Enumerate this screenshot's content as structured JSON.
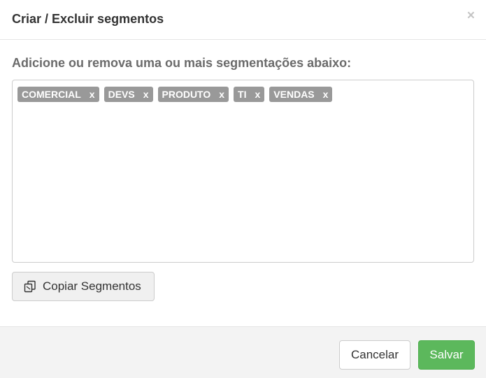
{
  "header": {
    "title": "Criar / Excluir segmentos",
    "close_label": "×"
  },
  "body": {
    "instruction": "Adicione ou remova uma ou mais segmentações abaixo:",
    "tags": [
      {
        "label": "COMERCIAL",
        "remove": "x"
      },
      {
        "label": "DEVS",
        "remove": "x"
      },
      {
        "label": "PRODUTO",
        "remove": "x"
      },
      {
        "label": "TI",
        "remove": "x"
      },
      {
        "label": "VENDAS",
        "remove": "x"
      }
    ],
    "copy_button": {
      "label": "Copiar Segmentos",
      "icon": "copy-icon"
    }
  },
  "footer": {
    "cancel_label": "Cancelar",
    "save_label": "Salvar"
  },
  "colors": {
    "tag_background": "#999999",
    "save_button": "#5cb85c",
    "footer_background": "#f3f3f3"
  }
}
